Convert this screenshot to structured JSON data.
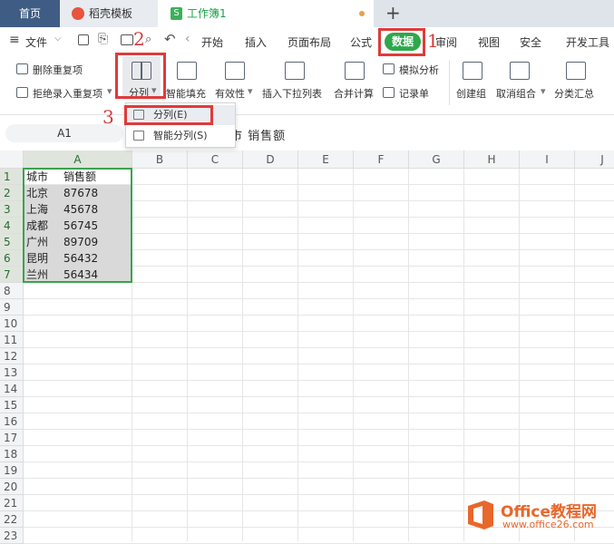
{
  "tabs": {
    "home": "首页",
    "template": "稻壳模板",
    "workbook": "工作簿1",
    "workbook_badge": "S",
    "new_tab": "+"
  },
  "menu": {
    "file": "文件",
    "items": [
      "开始",
      "插入",
      "页面布局",
      "公式",
      "数据",
      "审阅",
      "视图",
      "安全",
      "开发工具"
    ]
  },
  "ribbon": {
    "remove_dup": "删除重复项",
    "reject_dup": "拒绝录入重复项",
    "split": "分列",
    "smart_fill": "智能填充",
    "validity": "有效性",
    "dropdown_list": "插入下拉列表",
    "merge_calc": "合并计算",
    "simulate": "模拟分析",
    "record": "记录单",
    "create_group": "创建组",
    "ungroup": "取消组合",
    "subtotal": "分类汇总"
  },
  "formula_bar": {
    "name_box": "A1",
    "content": "城市 销售额"
  },
  "split_menu": {
    "items": [
      "分列(E)",
      "智能分列(S)"
    ]
  },
  "annotations": [
    "1",
    "2",
    "3"
  ],
  "sheet": {
    "columns": [
      "A",
      "B",
      "C",
      "D",
      "E",
      "F",
      "G",
      "H",
      "I",
      "J"
    ],
    "rows": [
      "1",
      "2",
      "3",
      "4",
      "5",
      "6",
      "7",
      "8",
      "9",
      "10",
      "11",
      "12",
      "13",
      "14",
      "15",
      "16",
      "17",
      "18",
      "19",
      "20",
      "21",
      "22",
      "23"
    ],
    "data": [
      [
        "城市",
        "销售额"
      ],
      [
        "北京",
        "87678"
      ],
      [
        "上海",
        "45678"
      ],
      [
        "成都",
        "56745"
      ],
      [
        "广州",
        "89709"
      ],
      [
        "昆明",
        "56432"
      ],
      [
        "兰州",
        "56434"
      ]
    ]
  },
  "watermark": {
    "brand": "Office教程网",
    "url": "www.office26.com"
  },
  "colors": {
    "accent_green": "#2ea84c",
    "annotation_red": "#e03a3a",
    "home_tab": "#3f5d84"
  }
}
